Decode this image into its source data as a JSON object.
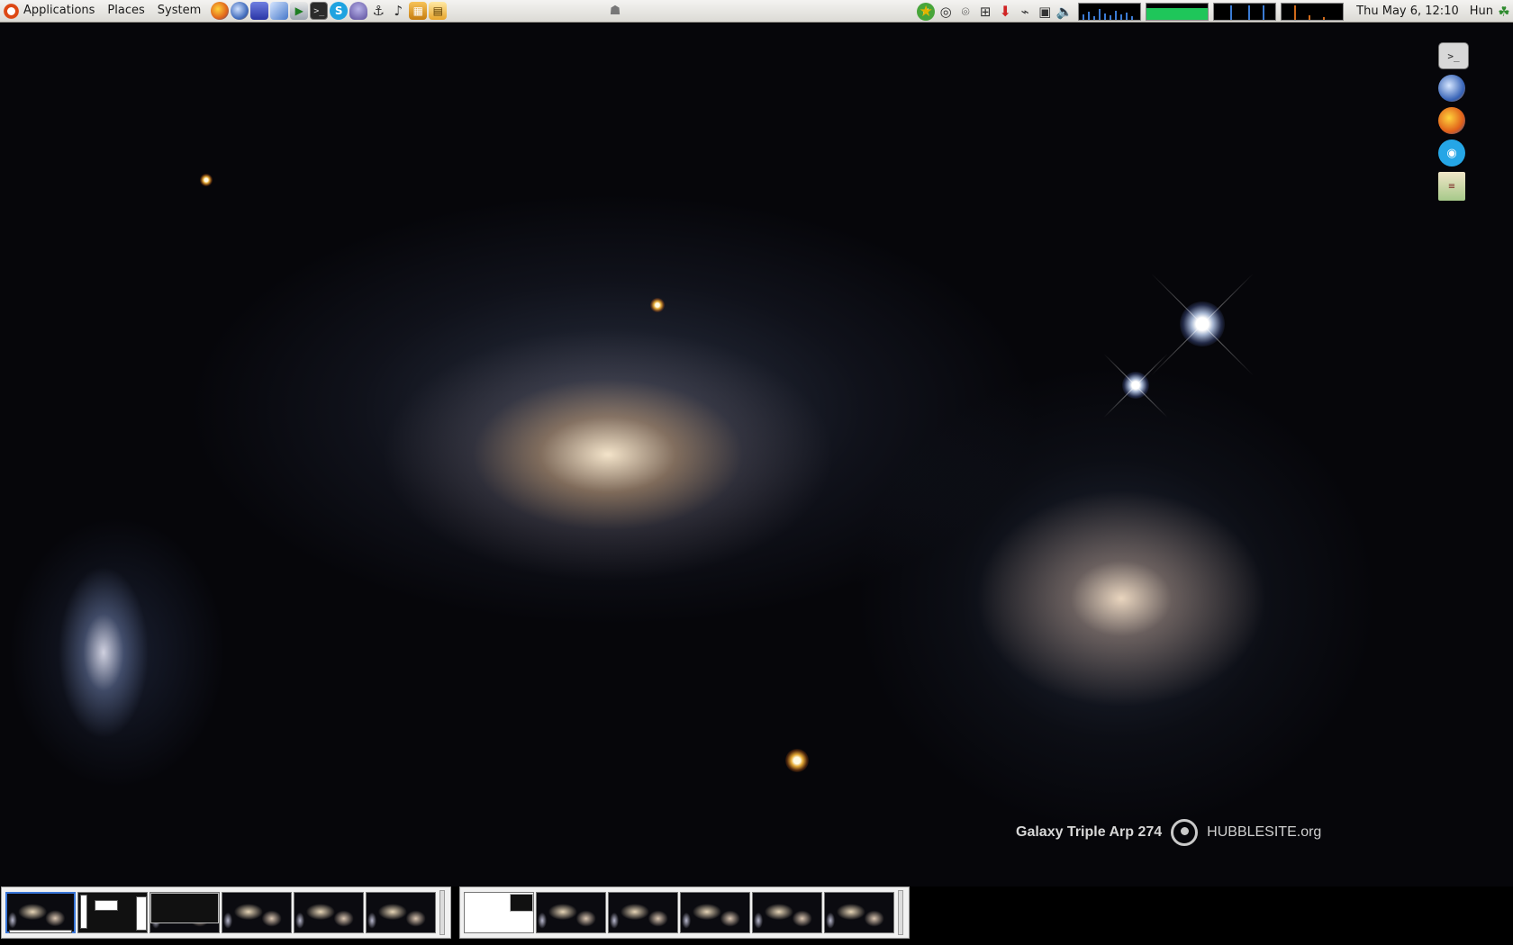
{
  "top_panel": {
    "menus": [
      "Applications",
      "Places",
      "System"
    ],
    "launchers": [
      "firefox-icon",
      "thunderbird-icon",
      "virtualbox-icon",
      "cube-icon",
      "install-icon",
      "terminal-icon",
      "skype-icon",
      "pidgin-icon",
      "network-icon",
      "audio-mixer-icon",
      "photo-icon",
      "notes-icon"
    ],
    "tray_icons": [
      "update-check-icon",
      "network-status-icon",
      "wireless-icon",
      "connection-icon",
      "favorites-star-icon",
      "download-icon",
      "plug-icon",
      "display-icon",
      "volume-icon"
    ],
    "clock": "Thu May  6, 12:10",
    "keyboard_layout": "Hun"
  },
  "wallpaper": {
    "caption_title": "Galaxy Triple Arp 274",
    "caption_site": "HUBBLESITE.org"
  },
  "desktop_launchers": [
    "terminal-icon",
    "thunderbird-icon",
    "firefox-icon",
    "chat-icon",
    "notepad-icon"
  ]
}
